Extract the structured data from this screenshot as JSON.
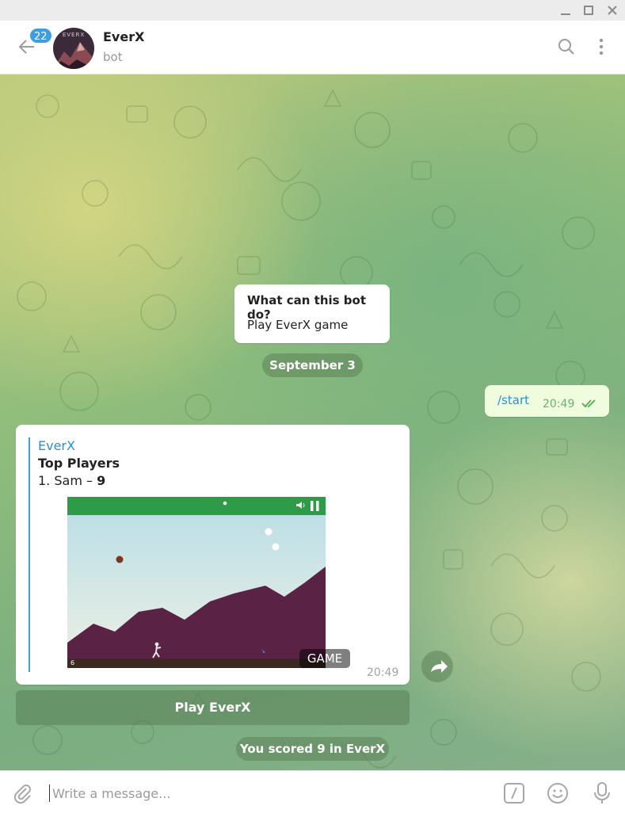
{
  "window": {
    "controls": [
      "minimize",
      "maximize",
      "close"
    ]
  },
  "header": {
    "unread_badge": "22",
    "avatar_text": "EVERX",
    "chat_name": "EverX",
    "chat_status": "bot",
    "icons": [
      "back-arrow-icon",
      "search-icon",
      "more-vertical-icon"
    ]
  },
  "messages": {
    "bot_info": {
      "title": "What can this bot do?",
      "text": "Play EverX game"
    },
    "date_separator": "September 3",
    "outgoing": {
      "text": "/start",
      "time": "20:49",
      "status": "read"
    },
    "game": {
      "bot_name": "EverX",
      "heading": "Top Players",
      "entry_rank_name": "1. Sam – ",
      "entry_score": "9",
      "game_label": "GAME",
      "time": "20:49",
      "canvas_score": "6"
    },
    "inline_button": "Play EverX",
    "service": "You scored 9 in EverX"
  },
  "composer": {
    "placeholder": "Write a message...",
    "icons": [
      "attach-icon",
      "bot-commands-icon",
      "emoji-icon",
      "microphone-icon"
    ]
  },
  "colors": {
    "accent": "#3f9ee1",
    "outgoing_bubble": "#effdde",
    "read_check": "#4fae4e",
    "game_bar": "#2e9c46",
    "mountain": "#5a2244"
  }
}
